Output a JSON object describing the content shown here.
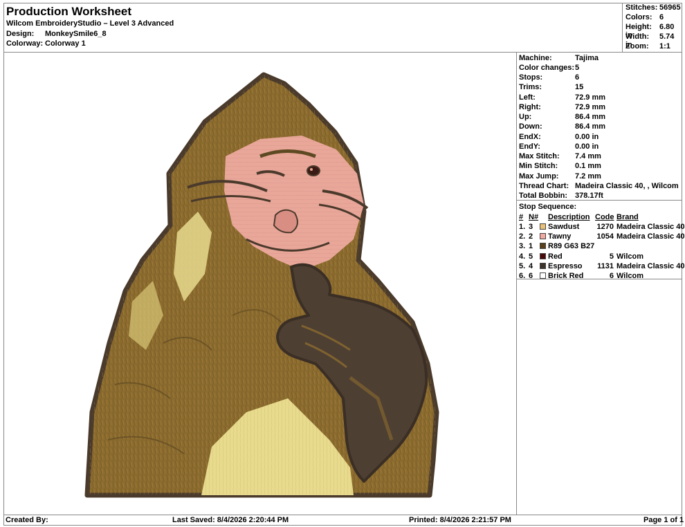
{
  "header": {
    "title": "Production Worksheet",
    "subtitle": "Wilcom EmbroideryStudio – Level 3 Advanced",
    "design_label": "Design:",
    "design_value": "MonkeySmile6_8",
    "colorway_label": "Colorway:",
    "colorway_value": "Colorway 1"
  },
  "stats": [
    {
      "label": "Stitches:",
      "value": "56965"
    },
    {
      "label": "Colors:",
      "value": "6"
    },
    {
      "label": "Height:",
      "value": "6.80 in"
    },
    {
      "label": "Width:",
      "value": "5.74 in"
    },
    {
      "label": "Zoom:",
      "value": "1:1"
    }
  ],
  "details": [
    {
      "label": "Machine:",
      "value": "Tajima"
    },
    {
      "label": "Color changes:",
      "value": "5"
    },
    {
      "label": "Stops:",
      "value": "6"
    },
    {
      "label": "Trims:",
      "value": "15"
    },
    {
      "label": "Left:",
      "value": "72.9 mm"
    },
    {
      "label": "Right:",
      "value": "72.9 mm"
    },
    {
      "label": "Up:",
      "value": "86.4 mm"
    },
    {
      "label": "Down:",
      "value": "86.4 mm"
    },
    {
      "label": "EndX:",
      "value": "0.00 in"
    },
    {
      "label": "EndY:",
      "value": "0.00 in"
    },
    {
      "label": "Max Stitch:",
      "value": "7.4 mm"
    },
    {
      "label": "Min Stitch:",
      "value": "0.1 mm"
    },
    {
      "label": "Max Jump:",
      "value": "7.2 mm"
    },
    {
      "label": "Thread Chart:",
      "value": "Madeira Classic 40, , Wilcom"
    },
    {
      "label": "Total Bobbin:",
      "value": "378.17ft"
    }
  ],
  "stop_sequence": {
    "title": "Stop Sequence:",
    "headers": {
      "num": "#",
      "n": "N#",
      "description": "Description",
      "code": "Code",
      "brand": "Brand"
    },
    "rows": [
      {
        "num": "1.",
        "n": "3",
        "color": "#E8C07A",
        "description": "Sawdust",
        "code": "1270",
        "brand": "Madeira Classic 40"
      },
      {
        "num": "2.",
        "n": "2",
        "color": "#F0A8A0",
        "description": "Tawny",
        "code": "1054",
        "brand": "Madeira Classic 40"
      },
      {
        "num": "3.",
        "n": "1",
        "color": "#593F1B",
        "description": "R89 G63 B27",
        "code": "",
        "brand": ""
      },
      {
        "num": "4.",
        "n": "5",
        "color": "#4A0A0A",
        "description": "Red",
        "code": "5",
        "brand": "Wilcom"
      },
      {
        "num": "5.",
        "n": "4",
        "color": "#3E332B",
        "description": "Espresso",
        "code": "1131",
        "brand": "Madeira Classic 40"
      },
      {
        "num": "6.",
        "n": "6",
        "color": "#FFFFFF",
        "description": "Brick Red",
        "code": "6",
        "brand": "Wilcom"
      }
    ]
  },
  "artwork": {
    "colors": {
      "fur": "#8C6B2E",
      "fur_dark": "#5E4A22",
      "fur_light": "#E8DB8E",
      "face": "#E9A79A",
      "hand": "#4E3F33",
      "outline": "#4A3A2C",
      "eye": "#3A1A12"
    }
  },
  "footer": {
    "created_by": "Created By:",
    "last_saved": "Last Saved: 8/4/2026 2:20:44 PM",
    "printed": "Printed: 8/4/2026 2:21:57 PM",
    "page": "Page 1 of 1"
  }
}
